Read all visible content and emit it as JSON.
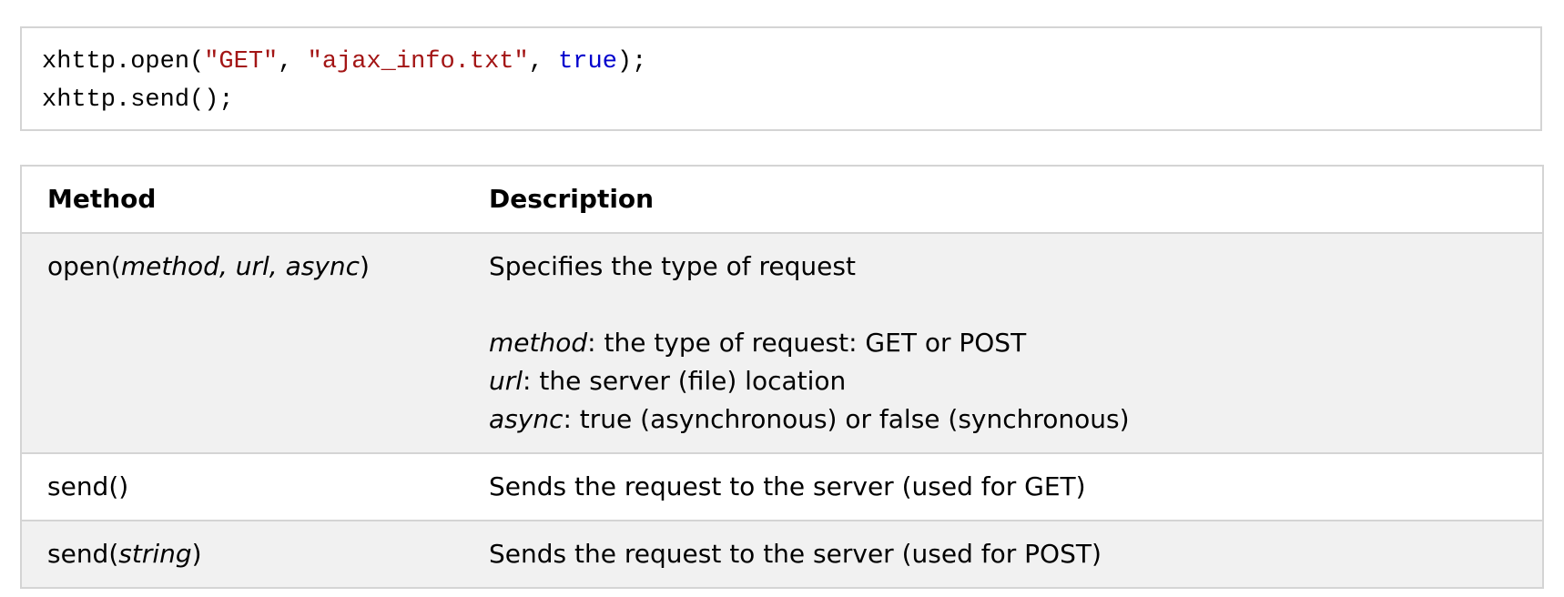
{
  "code": {
    "line1": {
      "t1": "xhttp.open(",
      "t2": "\"GET\"",
      "t3": ", ",
      "t4": "\"ajax_info.txt\"",
      "t5": ", ",
      "t6": "true",
      "t7": ");"
    },
    "line2": "xhttp.send();",
    "colors": {
      "string": "#a31515",
      "keyword": "#0000cd"
    }
  },
  "table": {
    "headers": {
      "method": "Method",
      "description": "Description"
    },
    "rows": [
      {
        "method_name": "open(",
        "method_params": "method, url, async",
        "method_close": ")",
        "summary": "Specifies the type of request",
        "params": [
          {
            "name": "method",
            "text": ": the type of request: GET or POST"
          },
          {
            "name": "url",
            "text": ": the server (file) location"
          },
          {
            "name": "async",
            "text": ": true (asynchronous) or false (synchronous)"
          }
        ]
      },
      {
        "method_name": "send()",
        "summary": "Sends the request to the server (used for GET)"
      },
      {
        "method_name": "send(",
        "method_params": "string",
        "method_close": ")",
        "summary": "Sends the request to the server (used for POST)"
      }
    ],
    "colors": {
      "shaded_row": "#f1f1f1",
      "border": "#d4d4d4"
    }
  }
}
